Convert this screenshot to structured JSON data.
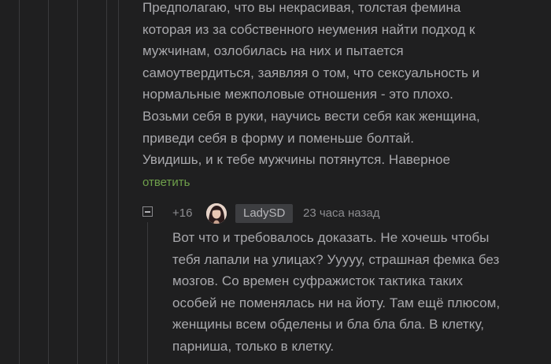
{
  "parent_comment": {
    "lines": [
      "Предполагаю, что вы некрасивая, толстая фемина",
      "которая из за собственного неумения найти подход к",
      "мужчинам, озлобилась на них и пытается",
      "самоутвердиться, заявляя о том, что сексуальность и",
      "нормальные  межполовые отношения  - это плохо.",
      "Возьми себя в руки, научись вести себя как женщина,",
      "приведи себя в форму и поменьше болтай.",
      "Увидишь, и к тебе мужчины потянутся. Наверное"
    ],
    "reply_label": "ответить"
  },
  "reply_comment": {
    "rating": "+16",
    "username": "LadySD",
    "timestamp": "23 часа назад",
    "lines": [
      "Вот что и требовалось доказать. Не хочешь чтобы",
      "тебя лапали на улицах? Ууууу, страшная фемка без",
      "мозгов. Со времен суфражисток тактика таких",
      "особей не поменялась ни на йоту.  Там ещё плюсом,",
      "женщины всем обделены и бла бла бла. В клетку,",
      "парниша, только в клетку."
    ]
  },
  "icons": {
    "collapse": "minus-square-icon",
    "avatar": "user-avatar"
  },
  "colors": {
    "background": "#1f1f20",
    "text": "#a9a9ad",
    "reply_link": "#6fa04b",
    "username_badge": "#3d3e41",
    "meta": "#8d8d91"
  }
}
